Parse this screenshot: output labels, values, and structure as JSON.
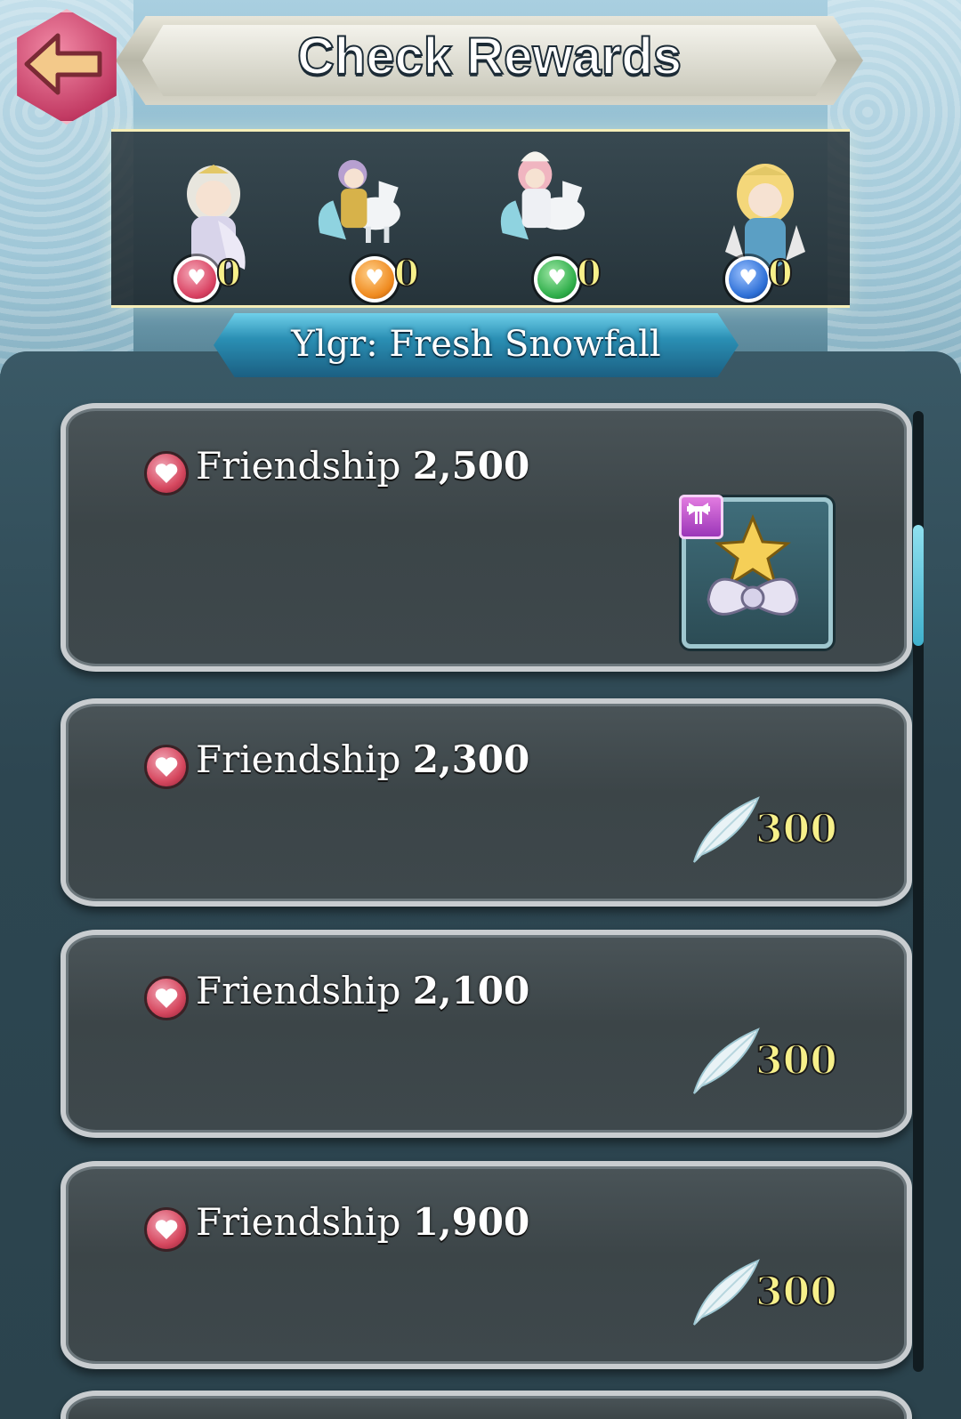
{
  "header": {
    "title": "Check Rewards",
    "back_icon": "back-arrow-icon"
  },
  "characters": [
    {
      "name": "unit-1",
      "heart_color": "#d94262",
      "support_count": "0"
    },
    {
      "name": "unit-2",
      "heart_color": "#ef8a1f",
      "support_count": "0"
    },
    {
      "name": "unit-3",
      "heart_color": "#2fae4a",
      "support_count": "0"
    },
    {
      "name": "unit-4",
      "heart_color": "#2d6fd6",
      "support_count": "0"
    }
  ],
  "banner": {
    "label": "Ylgr: Fresh Snowfall"
  },
  "rewards": [
    {
      "label": "Friendship",
      "value": "2,500",
      "reward_type": "accessory",
      "reward_icon": "accessory-star-bow-icon",
      "amount": ""
    },
    {
      "label": "Friendship",
      "value": "2,300",
      "reward_type": "feathers",
      "reward_icon": "feather-icon",
      "amount": "300"
    },
    {
      "label": "Friendship",
      "value": "2,100",
      "reward_type": "feathers",
      "reward_icon": "feather-icon",
      "amount": "300"
    },
    {
      "label": "Friendship",
      "value": "1,900",
      "reward_type": "feathers",
      "reward_icon": "feather-icon",
      "amount": "300"
    }
  ],
  "colors": {
    "accent": "#3fb0cc",
    "amount_text": "#f7f08a",
    "friendship_heart": "#d6485f"
  }
}
